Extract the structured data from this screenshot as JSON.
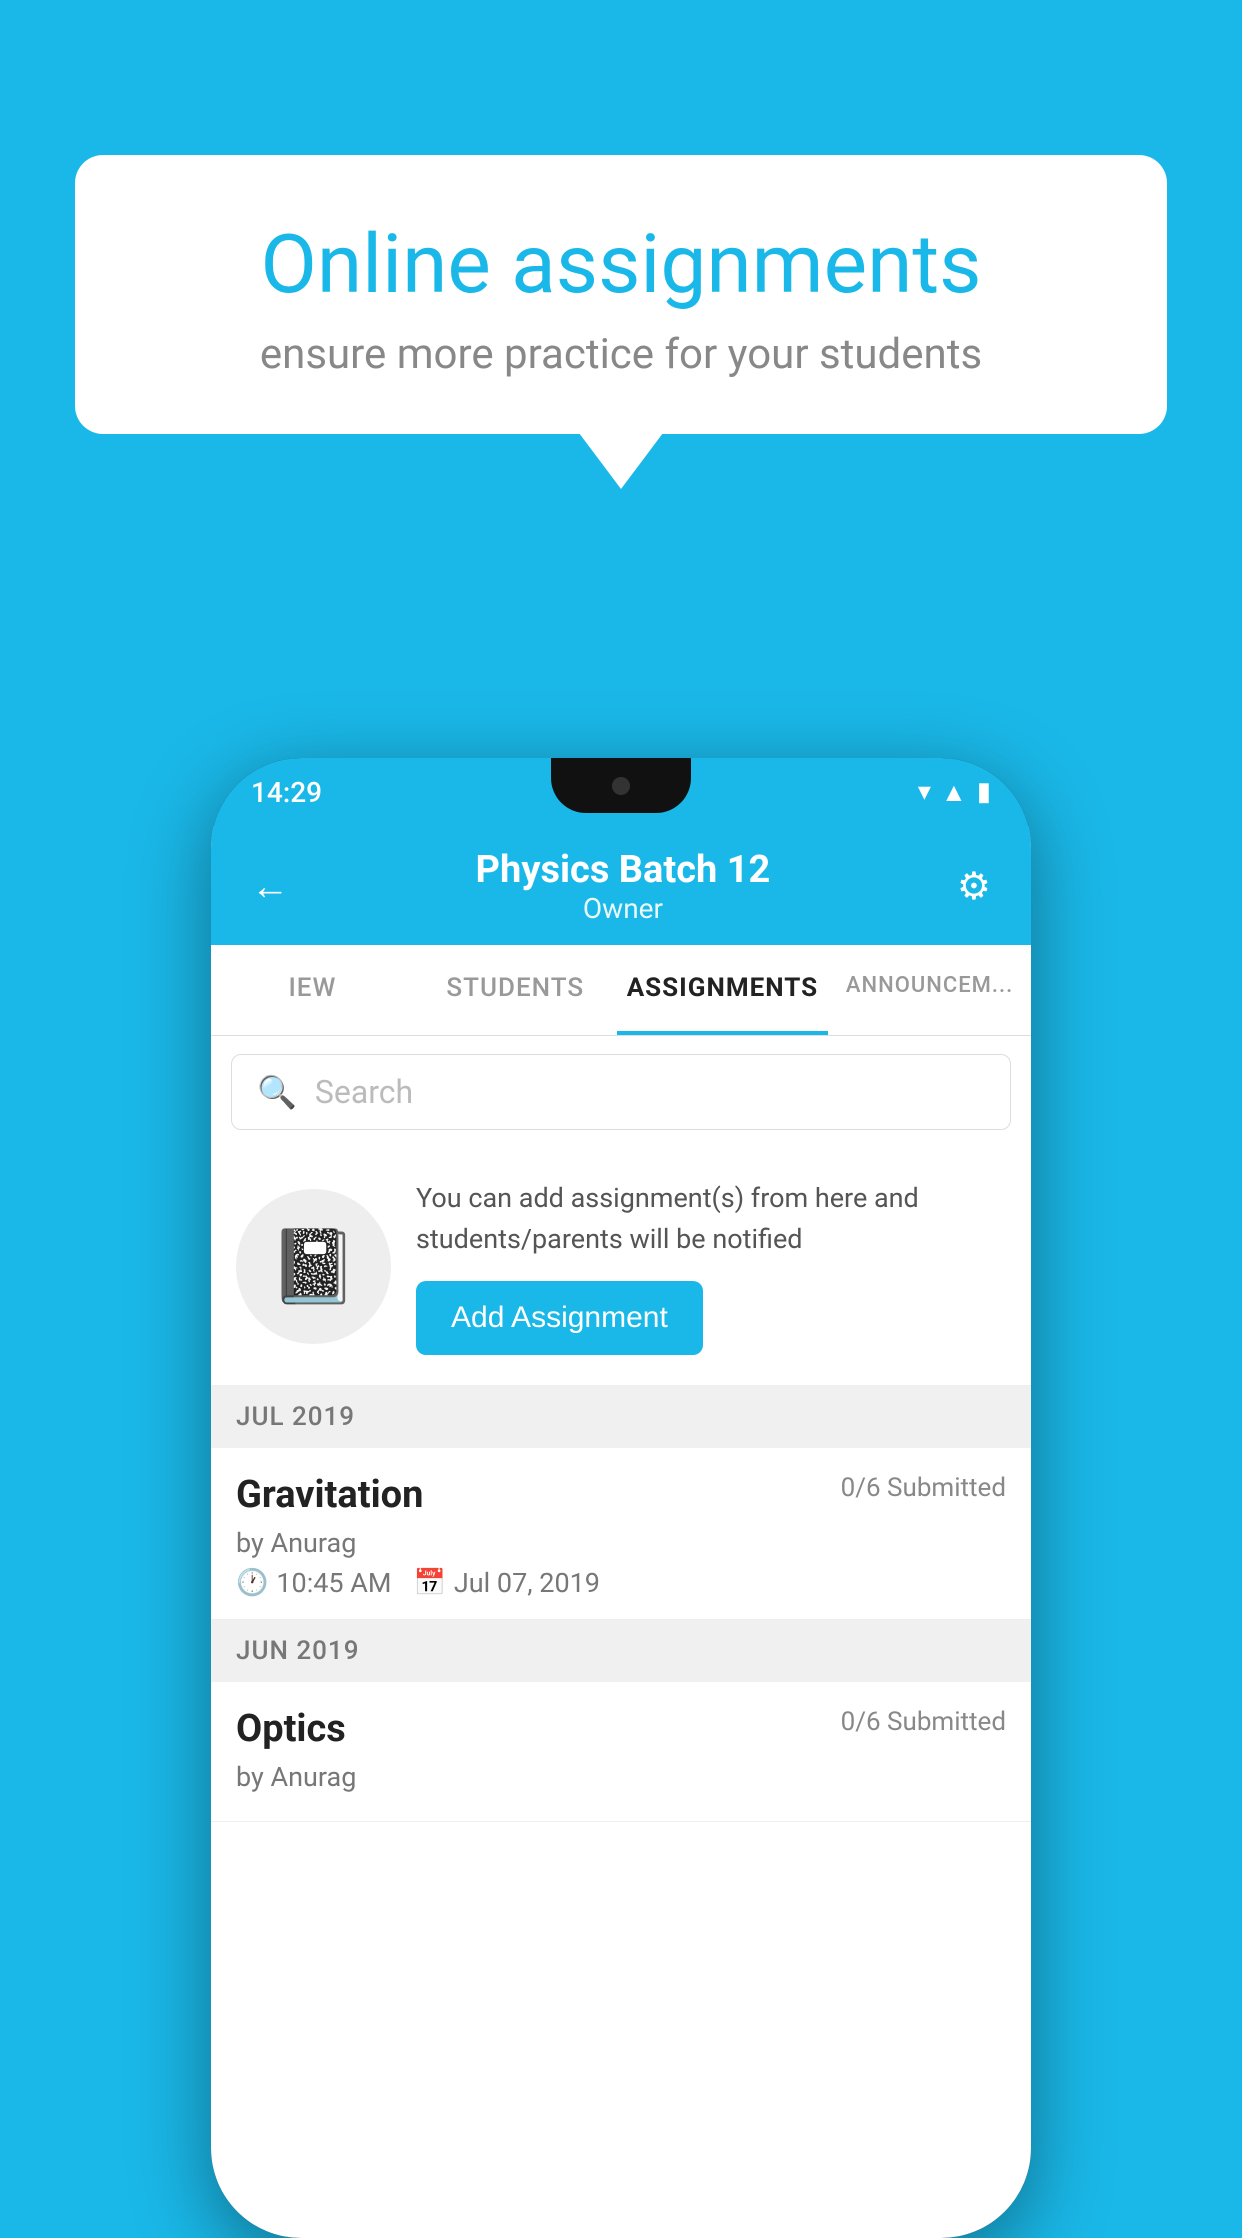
{
  "background_color": "#1ab8e8",
  "speech_bubble": {
    "title": "Online assignments",
    "subtitle": "ensure more practice for your students"
  },
  "phone": {
    "status_bar": {
      "time": "14:29"
    },
    "header": {
      "title": "Physics Batch 12",
      "subtitle": "Owner",
      "back_label": "←",
      "settings_label": "⚙"
    },
    "tabs": [
      {
        "label": "IEW",
        "active": false
      },
      {
        "label": "STUDENTS",
        "active": false
      },
      {
        "label": "ASSIGNMENTS",
        "active": true
      },
      {
        "label": "ANNOUNCEM...",
        "active": false
      }
    ],
    "search": {
      "placeholder": "Search"
    },
    "promo": {
      "text": "You can add assignment(s) from here and students/parents will be notified",
      "button_label": "Add Assignment"
    },
    "sections": [
      {
        "month": "JUL 2019",
        "assignments": [
          {
            "title": "Gravitation",
            "submitted": "0/6 Submitted",
            "by": "by Anurag",
            "time": "10:45 AM",
            "date": "Jul 07, 2019"
          }
        ]
      },
      {
        "month": "JUN 2019",
        "assignments": [
          {
            "title": "Optics",
            "submitted": "0/6 Submitted",
            "by": "by Anurag",
            "time": "",
            "date": ""
          }
        ]
      }
    ]
  }
}
